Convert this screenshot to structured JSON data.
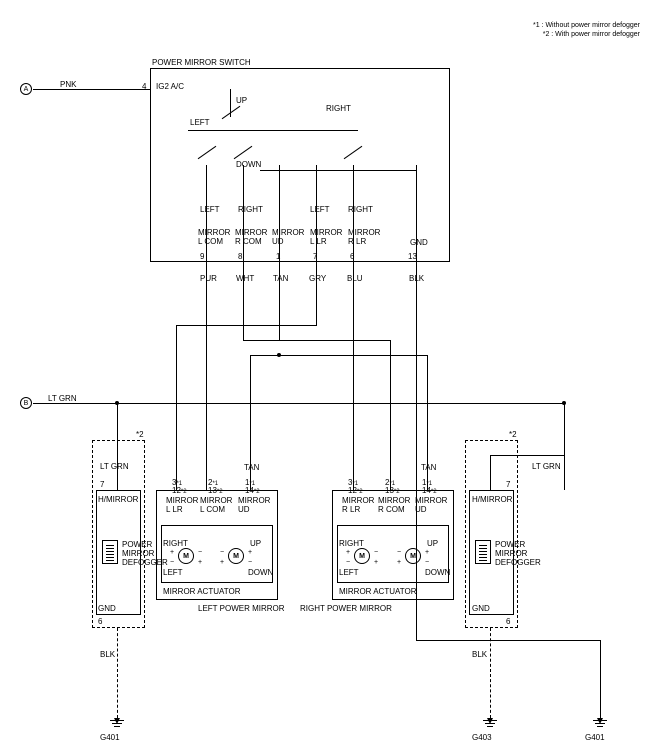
{
  "legend": {
    "note1": "*1 : Without power mirror defogger",
    "note2": "*2 : With power mirror defogger"
  },
  "inputs": {
    "a_color": "PNK",
    "b_color": "LT GRN"
  },
  "switch": {
    "title": "POWER MIRROR SWITCH",
    "pin4_label": "IG2 A/C",
    "pin4": "4",
    "up": "UP",
    "down": "DOWN",
    "left": "LEFT",
    "right": "RIGHT",
    "left2": "LEFT",
    "right2": "RIGHT",
    "left3": "LEFT",
    "right3": "RIGHT",
    "terms": {
      "t9_name": "MIRROR\nL COM",
      "t9_pin": "9",
      "t8_name": "MIRROR\nR COM",
      "t8_pin": "8",
      "t1_name": "MIRROR\nUD",
      "t1_pin": "1",
      "t7_name": "MIRROR\nL LR",
      "t7_pin": "7",
      "t6_name": "MIRROR\nR LR",
      "t6_pin": "6",
      "t13_name": "GND",
      "t13_pin": "13"
    },
    "wires": {
      "w9": "PUR",
      "w8": "WHT",
      "w1": "TAN",
      "w7": "GRY",
      "w6": "BLU",
      "w13": "BLK"
    }
  },
  "left_mirror": {
    "title": "LEFT POWER MIRROR",
    "star": "*2",
    "hmirror": "H/MIRROR",
    "pin7": "7",
    "ltgrn": "LT GRN",
    "gnd_label": "GND",
    "gnd_pin": "6",
    "blk": "BLK",
    "ground": "G401",
    "actuator": "MIRROR ACTUATOR",
    "defogger": "POWER\nMIRROR\nDEFOGGER",
    "t3": {
      "pin": "3",
      "sub": "12",
      "name": "MIRROR\nL LR"
    },
    "t2": {
      "pin": "2",
      "sub": "13",
      "name": "MIRROR\nL COM"
    },
    "t1": {
      "pin": "1",
      "sub": "14",
      "name": "MIRROR\nUD"
    },
    "tan": "TAN",
    "m1": {
      "right": "RIGHT",
      "left": "LEFT"
    },
    "m2": {
      "up": "UP",
      "down": "DOWN"
    }
  },
  "right_mirror": {
    "title": "RIGHT POWER MIRROR",
    "star": "*2",
    "hmirror": "H/MIRROR",
    "pin7": "7",
    "ltgrn": "LT GRN",
    "gnd_label": "GND",
    "gnd_pin": "6",
    "blk": "BLK",
    "ground": "G403",
    "ground2": "G401",
    "actuator": "MIRROR ACTUATOR",
    "defogger": "POWER\nMIRROR\nDEFOGGER",
    "t3": {
      "pin": "3",
      "sub": "12",
      "name": "MIRROR\nR LR"
    },
    "t2": {
      "pin": "2",
      "sub": "13",
      "name": "MIRROR\nR COM"
    },
    "t1": {
      "pin": "1",
      "sub": "14",
      "name": "MIRROR\nUD"
    },
    "tan": "TAN",
    "m1": {
      "right": "RIGHT",
      "left": "LEFT"
    },
    "m2": {
      "up": "UP",
      "down": "DOWN"
    }
  },
  "star_marks": {
    "s1": "*1",
    "s2": "*2"
  }
}
